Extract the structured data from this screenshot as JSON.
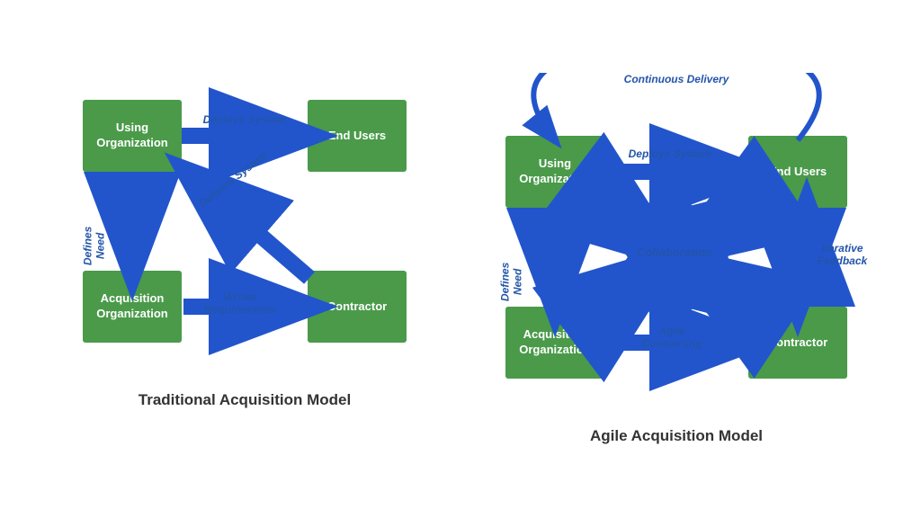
{
  "traditional": {
    "title": "Traditional Acquisition Model",
    "boxes": {
      "using_org": "Using\nOrganization",
      "end_users": "End Users",
      "acq_org": "Acquisition\nOrganization",
      "contractor": "Contractor"
    },
    "arrows": {
      "deploys": "Deploys System",
      "defines": "Defines Need",
      "writes": "Writes\nRequirements",
      "delivers": "Delivers System"
    }
  },
  "agile": {
    "title": "Agile Acquisition Model",
    "boxes": {
      "using_org": "Using\nOrganization",
      "end_users": "End Users",
      "acq_org": "Acquisition\nOrganization",
      "contractor": "Contractor"
    },
    "arrows": {
      "deploys": "Deploys System",
      "defines": "Defines Need",
      "agile": "Agile\nContracting",
      "iterative": "Iterative\nFeedback",
      "collaboration": "Collaboration",
      "continuous": "Continuous Delivery"
    }
  }
}
